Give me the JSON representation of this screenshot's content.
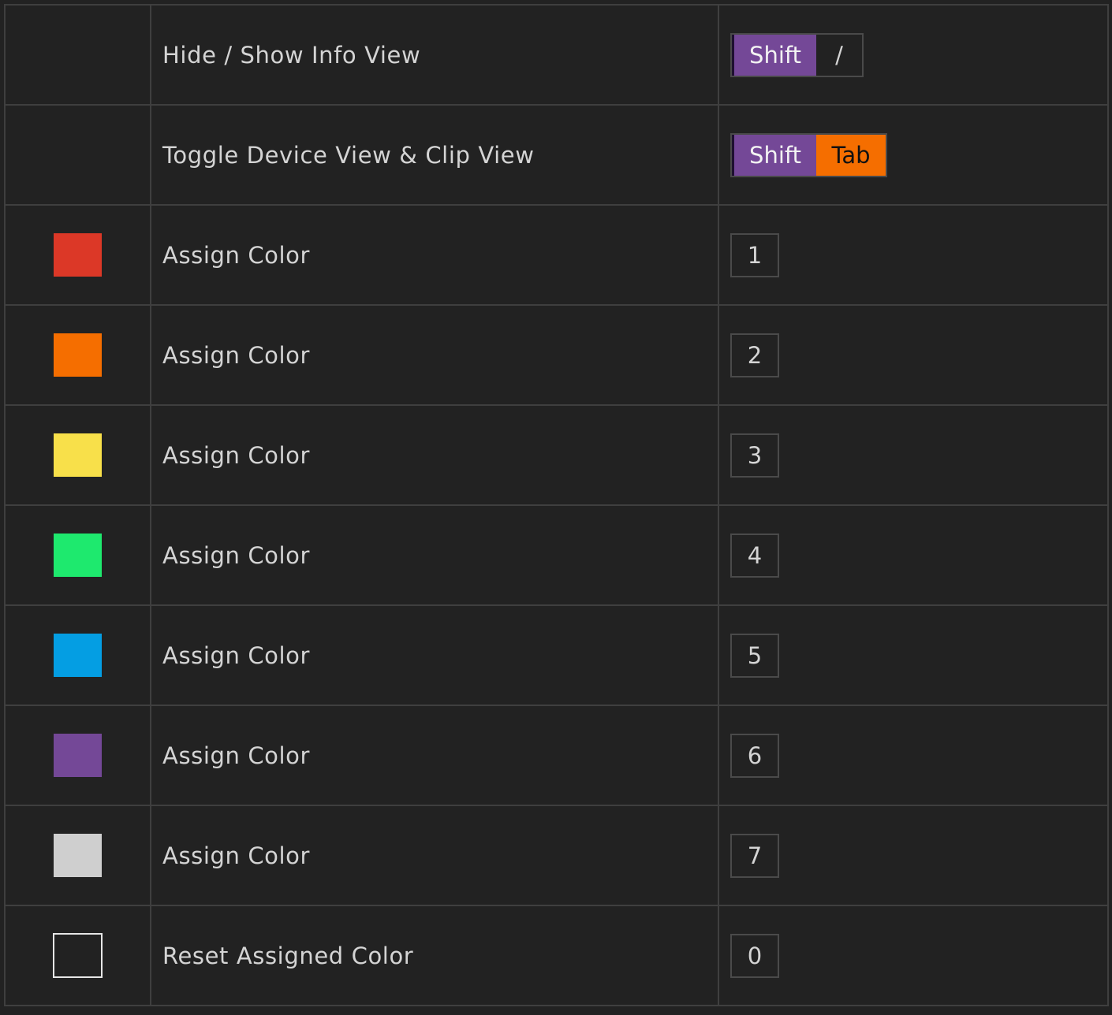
{
  "rows": [
    {
      "swatch": "none",
      "label": "Hide / Show Info View",
      "keys": [
        {
          "text": "Shift",
          "style": "shift"
        },
        {
          "text": "/",
          "style": "plain"
        }
      ]
    },
    {
      "swatch": "none",
      "label": "Toggle Device View & Clip View",
      "keys": [
        {
          "text": "Shift",
          "style": "shift"
        },
        {
          "text": "Tab",
          "style": "tab"
        }
      ]
    },
    {
      "swatch": "#dc3827",
      "label": "Assign Color",
      "keys": [
        {
          "text": "1",
          "style": "single"
        }
      ]
    },
    {
      "swatch": "#f56e00",
      "label": "Assign Color",
      "keys": [
        {
          "text": "2",
          "style": "single"
        }
      ]
    },
    {
      "swatch": "#f8e04a",
      "label": "Assign Color",
      "keys": [
        {
          "text": "3",
          "style": "single"
        }
      ]
    },
    {
      "swatch": "#1ee96e",
      "label": "Assign Color",
      "keys": [
        {
          "text": "4",
          "style": "single"
        }
      ]
    },
    {
      "swatch": "#049ee3",
      "label": "Assign Color",
      "keys": [
        {
          "text": "5",
          "style": "single"
        }
      ]
    },
    {
      "swatch": "#744897",
      "label": "Assign Color",
      "keys": [
        {
          "text": "6",
          "style": "single"
        }
      ]
    },
    {
      "swatch": "#cfcfcf",
      "label": "Assign Color",
      "keys": [
        {
          "text": "7",
          "style": "single"
        }
      ]
    },
    {
      "swatch": "outline",
      "label": "Reset Assigned Color",
      "keys": [
        {
          "text": "0",
          "style": "single"
        }
      ]
    }
  ],
  "colors": {
    "background": "#222222",
    "grid_line": "#3f3f3f",
    "shift_key": "#744897",
    "tab_key": "#f56e00"
  }
}
